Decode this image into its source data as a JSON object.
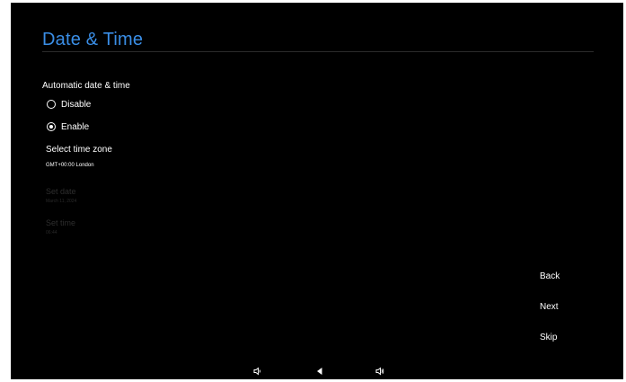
{
  "header": {
    "title": "Date & Time"
  },
  "automatic": {
    "label": "Automatic date & time",
    "options": [
      {
        "label": "Disable",
        "selected": false
      },
      {
        "label": "Enable",
        "selected": true
      }
    ]
  },
  "timezone": {
    "title": "Select time zone",
    "value": "GMT+00:00 London"
  },
  "set_date": {
    "title": "Set date",
    "value": "March 11, 2024"
  },
  "set_time": {
    "title": "Set time",
    "value": "06:44"
  },
  "buttons": {
    "back": "Back",
    "next": "Next",
    "skip": "Skip"
  },
  "system_nav": {
    "icons": [
      "volume-down-icon",
      "back-triangle-icon",
      "volume-up-icon"
    ]
  },
  "colors": {
    "accent": "#3a8ee6",
    "background": "#000000",
    "text": "#ffffff",
    "disabled_text": "#2e2e2e"
  }
}
